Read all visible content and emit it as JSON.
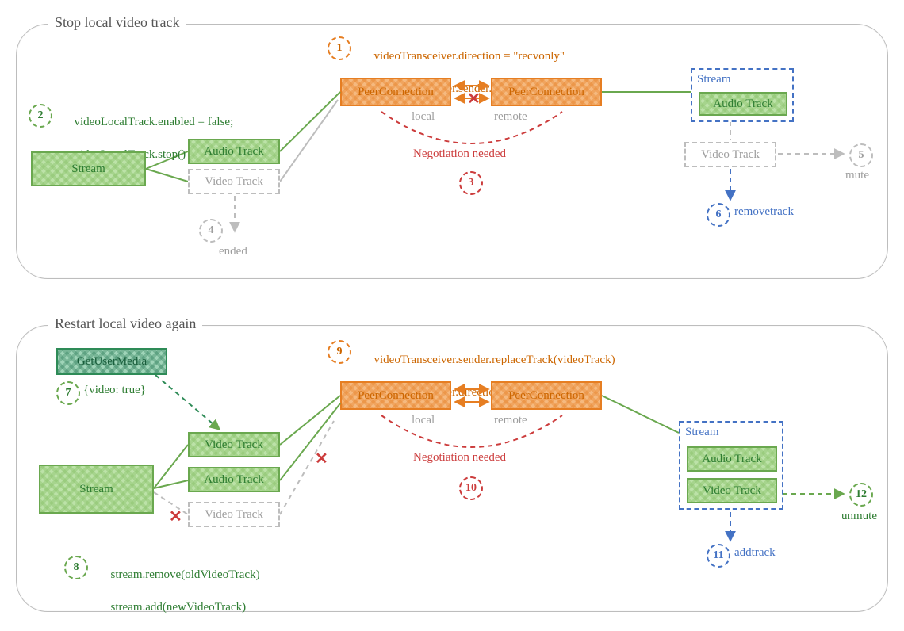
{
  "panel_top": {
    "title": "Stop local video track",
    "step1": {
      "num": "1",
      "lines": [
        "videoTransceiver.direction = \"recvonly\"",
        "videoTransceiver.sender.replaceTrack(null)"
      ]
    },
    "step2": {
      "num": "2",
      "lines": [
        "videoLocalTrack.enabled = false;",
        "videoLocalTrack.stop()"
      ]
    },
    "step3": {
      "num": "3"
    },
    "step4": {
      "num": "4",
      "label": "ended"
    },
    "step5": {
      "num": "5",
      "label": "mute"
    },
    "step6": {
      "num": "6",
      "label": "removetrack"
    },
    "pc_local": "PeerConnection",
    "pc_remote": "PeerConnection",
    "pc_local_sub": "local",
    "pc_remote_sub": "remote",
    "negotiation": "Negotiation needed",
    "stream_left": "Stream",
    "audio_track": "Audio Track",
    "video_track_gray": "Video Track",
    "remote_stream_label": "Stream",
    "remote_audio": "Audio Track",
    "remote_video_gray": "Video Track"
  },
  "panel_bottom": {
    "title": "Restart local video again",
    "step7": {
      "num": "7",
      "label": "{video: true}"
    },
    "step8": {
      "num": "8",
      "lines": [
        "stream.remove(oldVideoTrack)",
        "stream.add(newVideoTrack)"
      ]
    },
    "step9": {
      "num": "9",
      "lines": [
        "videoTransceiver.sender.replaceTrack(videoTrack)",
        "videoTransceiver.direction = \"sendrecv\""
      ]
    },
    "step10": {
      "num": "10"
    },
    "step11": {
      "num": "11",
      "label": "addtrack"
    },
    "step12": {
      "num": "12",
      "label": "unmute"
    },
    "gum": "GetUserMedia",
    "stream_left": "Stream",
    "video_track_new": "Video Track",
    "audio_track": "Audio Track",
    "video_track_old": "Video Track",
    "pc_local": "PeerConnection",
    "pc_remote": "PeerConnection",
    "pc_local_sub": "local",
    "pc_remote_sub": "remote",
    "negotiation": "Negotiation needed",
    "remote_stream_label": "Stream",
    "remote_audio": "Audio Track",
    "remote_video": "Video Track"
  }
}
